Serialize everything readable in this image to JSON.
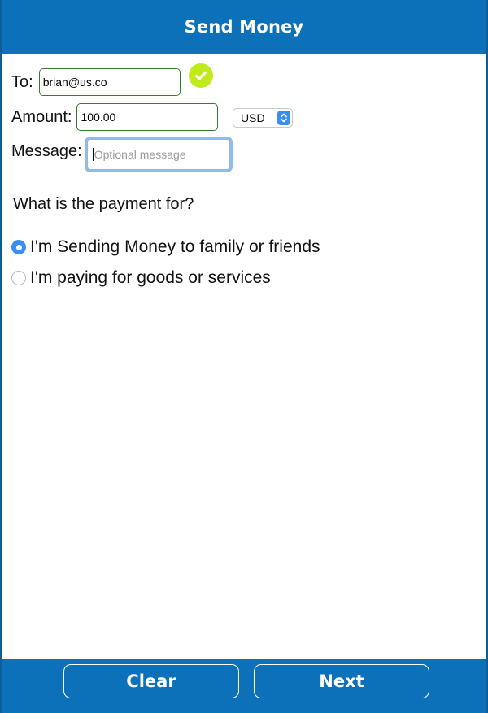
{
  "header": {
    "title": "Send Money"
  },
  "form": {
    "to_label": "To:",
    "to_value": "brian@us.co",
    "to_valid_icon": "checkmark-circle-icon",
    "amount_label": "Amount:",
    "amount_value": "100.00",
    "currency_selected": "USD",
    "message_label": "Message:",
    "message_placeholder": "Optional message"
  },
  "payment_purpose": {
    "question": "What is the payment for?",
    "options": [
      {
        "label": "I'm Sending Money to family or friends",
        "selected": true
      },
      {
        "label": "I'm paying for goods or services",
        "selected": false
      }
    ]
  },
  "footer": {
    "clear_label": "Clear",
    "next_label": "Next"
  },
  "colors": {
    "brand_blue": "#0d71b9",
    "valid_green": "#c1ea1a",
    "field_border_green": "#2f7d2f",
    "radio_selected_blue": "#3b8ff2"
  }
}
